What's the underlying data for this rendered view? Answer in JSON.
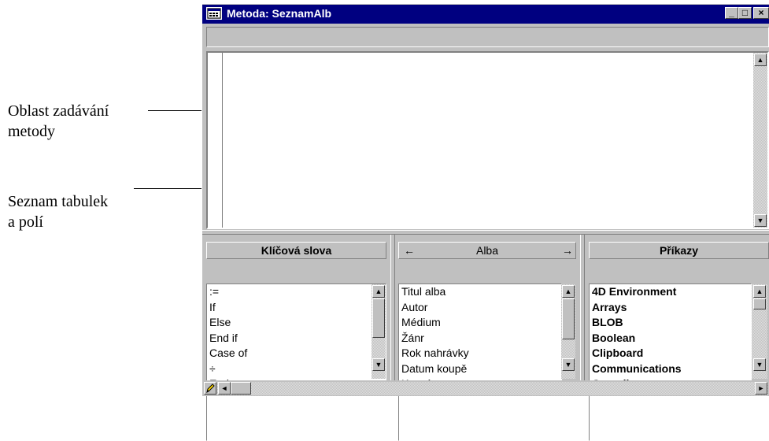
{
  "window": {
    "title": "Metoda: SeznamAlb",
    "controls": {
      "minimize": "_",
      "maximize": "□",
      "close": "×"
    }
  },
  "callouts": [
    {
      "line1": "Oblast zadávání",
      "line2": "metody"
    },
    {
      "line1": "Seznam tabulek",
      "line2": "a polí"
    }
  ],
  "panels": {
    "keywords": {
      "header": "Klíčová slova",
      "items": [
        ":=",
        "If",
        "Else",
        "End if",
        "Case of",
        "÷",
        "End case"
      ]
    },
    "tables": {
      "header": "Alba",
      "prev_arrow": "←",
      "next_arrow": "→",
      "items": [
        "Titul alba",
        "Autor",
        "Médium",
        "Žánr",
        "Rok nahrávky",
        "Datum koupě",
        "Kupní cena"
      ]
    },
    "commands": {
      "header": "Příkazy",
      "items": [
        "4D Environment",
        "Arrays",
        "BLOB",
        "Boolean",
        "Clipboard",
        "Communications",
        "Compiler"
      ]
    }
  },
  "icons": {
    "app": "method-window-icon",
    "pencil": "pencil-icon",
    "scroll_up": "▲",
    "scroll_down": "▼",
    "scroll_left": "◄",
    "scroll_right": "►"
  },
  "colors": {
    "titlebar": "#000080",
    "chrome": "#c0c0c0"
  }
}
